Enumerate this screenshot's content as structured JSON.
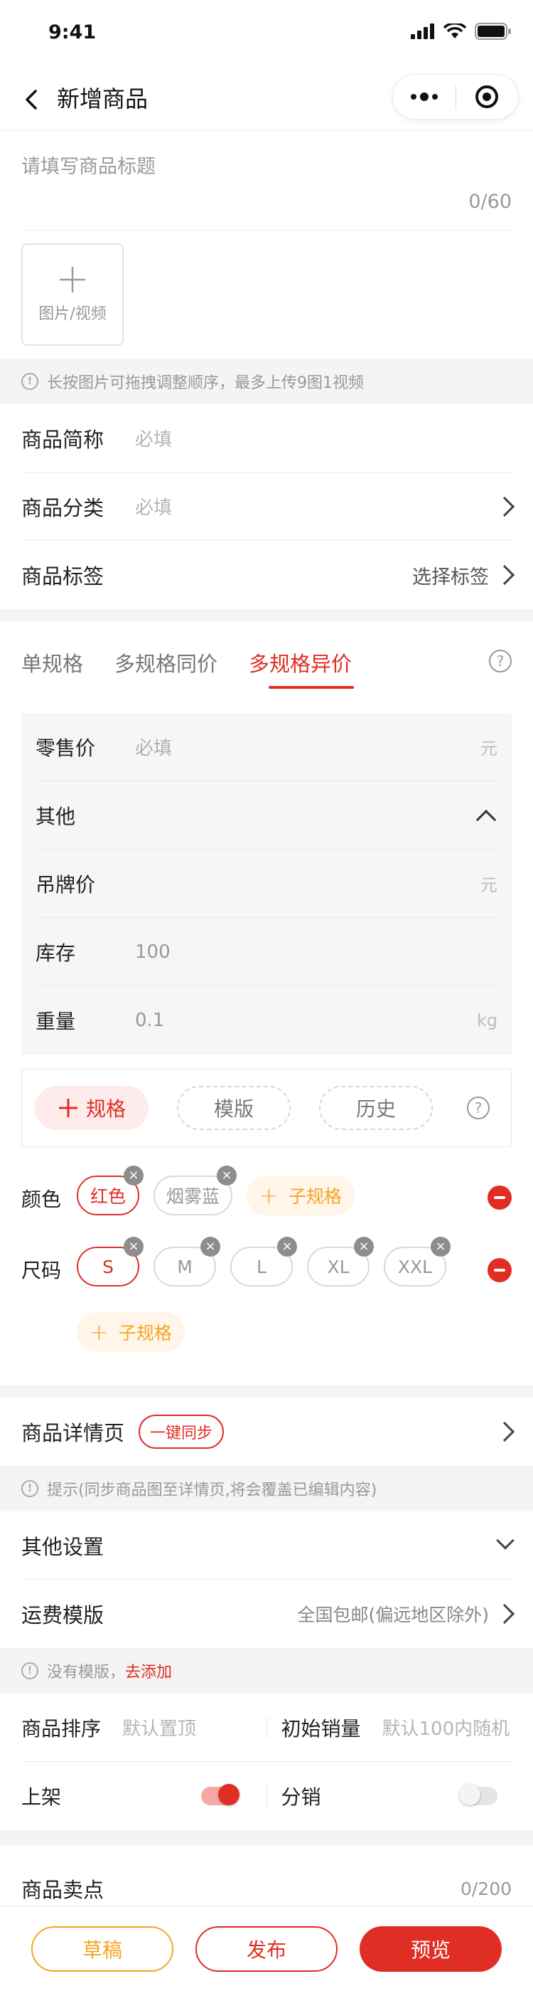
{
  "status_bar": {
    "time": "9:41"
  },
  "nav": {
    "title": "新增商品"
  },
  "title_input": {
    "placeholder": "请填写商品标题",
    "count": "0/60"
  },
  "upload": {
    "label": "图片/视频"
  },
  "tips": {
    "upload": "长按图片可拖拽调整顺序，最多上传9图1视频",
    "sync": "提示(同步商品图至详情页,将会覆盖已编辑内容)",
    "template_prefix": "没有模版，",
    "template_link": "去添加"
  },
  "basic_rows": [
    {
      "label": "商品简称",
      "placeholder": "必填"
    },
    {
      "label": "商品分类",
      "placeholder": "必填"
    },
    {
      "label": "商品标签",
      "value": "选择标签"
    }
  ],
  "spec_tabs": [
    "单规格",
    "多规格同价",
    "多规格异价"
  ],
  "price_rows": {
    "retail": {
      "label": "零售价",
      "placeholder": "必填",
      "unit": "元"
    },
    "other": {
      "label": "其他"
    },
    "tag_price": {
      "label": "吊牌价",
      "unit": "元"
    },
    "stock": {
      "label": "库存",
      "value": "100"
    },
    "weight": {
      "label": "重量",
      "value": "0.1",
      "unit": "kg"
    }
  },
  "spec_tools": {
    "spec": "规格",
    "template": "模版",
    "history": "历史"
  },
  "spec_groups": [
    {
      "name": "颜色",
      "options": [
        "红色",
        "烟雾蓝"
      ],
      "add_label": "子规格"
    },
    {
      "name": "尺码",
      "options": [
        "S",
        "M",
        "L",
        "XL",
        "XXL"
      ],
      "add_label": "子规格"
    }
  ],
  "detail": {
    "label": "商品详情页",
    "sync_button": "一键同步"
  },
  "other_settings": {
    "label": "其他设置"
  },
  "shipping": {
    "label": "运费模版",
    "value": "全国包邮(偏远地区除外)"
  },
  "sort_sales": {
    "sort_label": "商品排序",
    "sort_placeholder": "默认置顶",
    "sales_label": "初始销量",
    "sales_placeholder": "默认100内随机"
  },
  "toggles": {
    "shelf_label": "上架",
    "distribution_label": "分销"
  },
  "selling_point": {
    "label": "商品卖点",
    "count": "0/200"
  },
  "actions": {
    "draft": "草稿",
    "publish": "发布",
    "preview": "预览"
  },
  "colors": {
    "accent": "#e02e24",
    "orange": "#f5a623",
    "background": "#f4f4f4"
  }
}
